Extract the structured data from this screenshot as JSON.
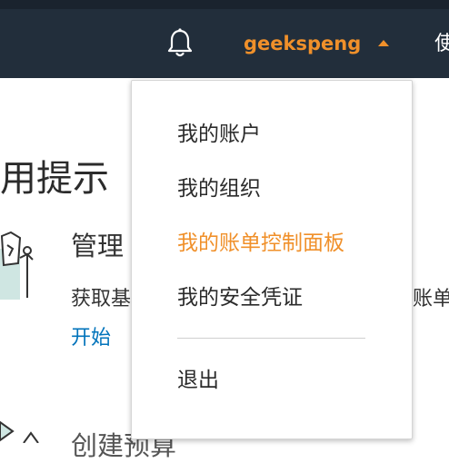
{
  "topbar": {
    "username": "geekspeng",
    "cutoff_text": "使"
  },
  "main": {
    "heading": "用提示",
    "card1": {
      "title": "管理",
      "desc_left": "获取基",
      "desc_right": "账单",
      "link": "开始"
    },
    "card2": {
      "title": "创建预算"
    }
  },
  "dropdown": {
    "items": [
      {
        "label": "我的账户"
      },
      {
        "label": "我的组织"
      },
      {
        "label": "我的账单控制面板"
      },
      {
        "label": "我的安全凭证"
      }
    ],
    "signout": "退出"
  },
  "colors": {
    "topbar_bg": "#222e3b",
    "accent": "#f0902a",
    "link": "#0073bb"
  },
  "icons": [
    "bell-icon",
    "caret-up-icon"
  ]
}
